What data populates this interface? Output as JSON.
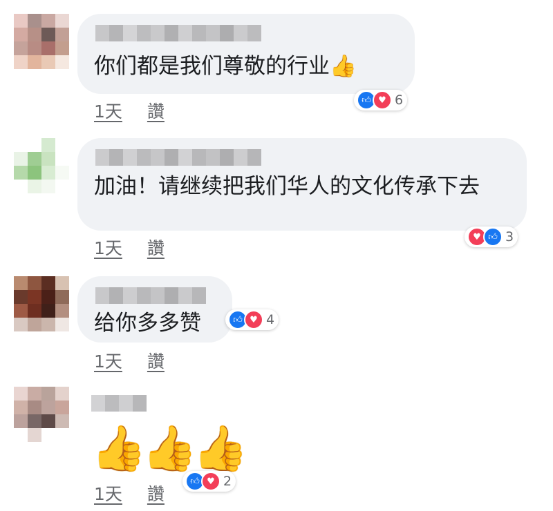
{
  "comments": [
    {
      "text": "你们都是我们尊敬的行业",
      "emoji": "👍",
      "reaction_count": "6",
      "time": "1天",
      "like_label": "讚"
    },
    {
      "text": "加油！请继续把我们华人的文化传承下去",
      "reaction_count": "3",
      "time": "1天",
      "like_label": "讚"
    },
    {
      "text": "给你多多赞",
      "reaction_count": "4",
      "time": "1天",
      "like_label": "讚"
    },
    {
      "emoji_content": "👍👍👍",
      "reaction_count": "2",
      "time": "1天",
      "like_label": "讚"
    }
  ],
  "icons": {
    "like": "like-reaction-icon",
    "love": "love-reaction-icon"
  },
  "colors": {
    "bubble": "#f0f2f5",
    "like_blue": "#1877f2",
    "love_red": "#f33e58",
    "meta_gray": "#65676b"
  }
}
